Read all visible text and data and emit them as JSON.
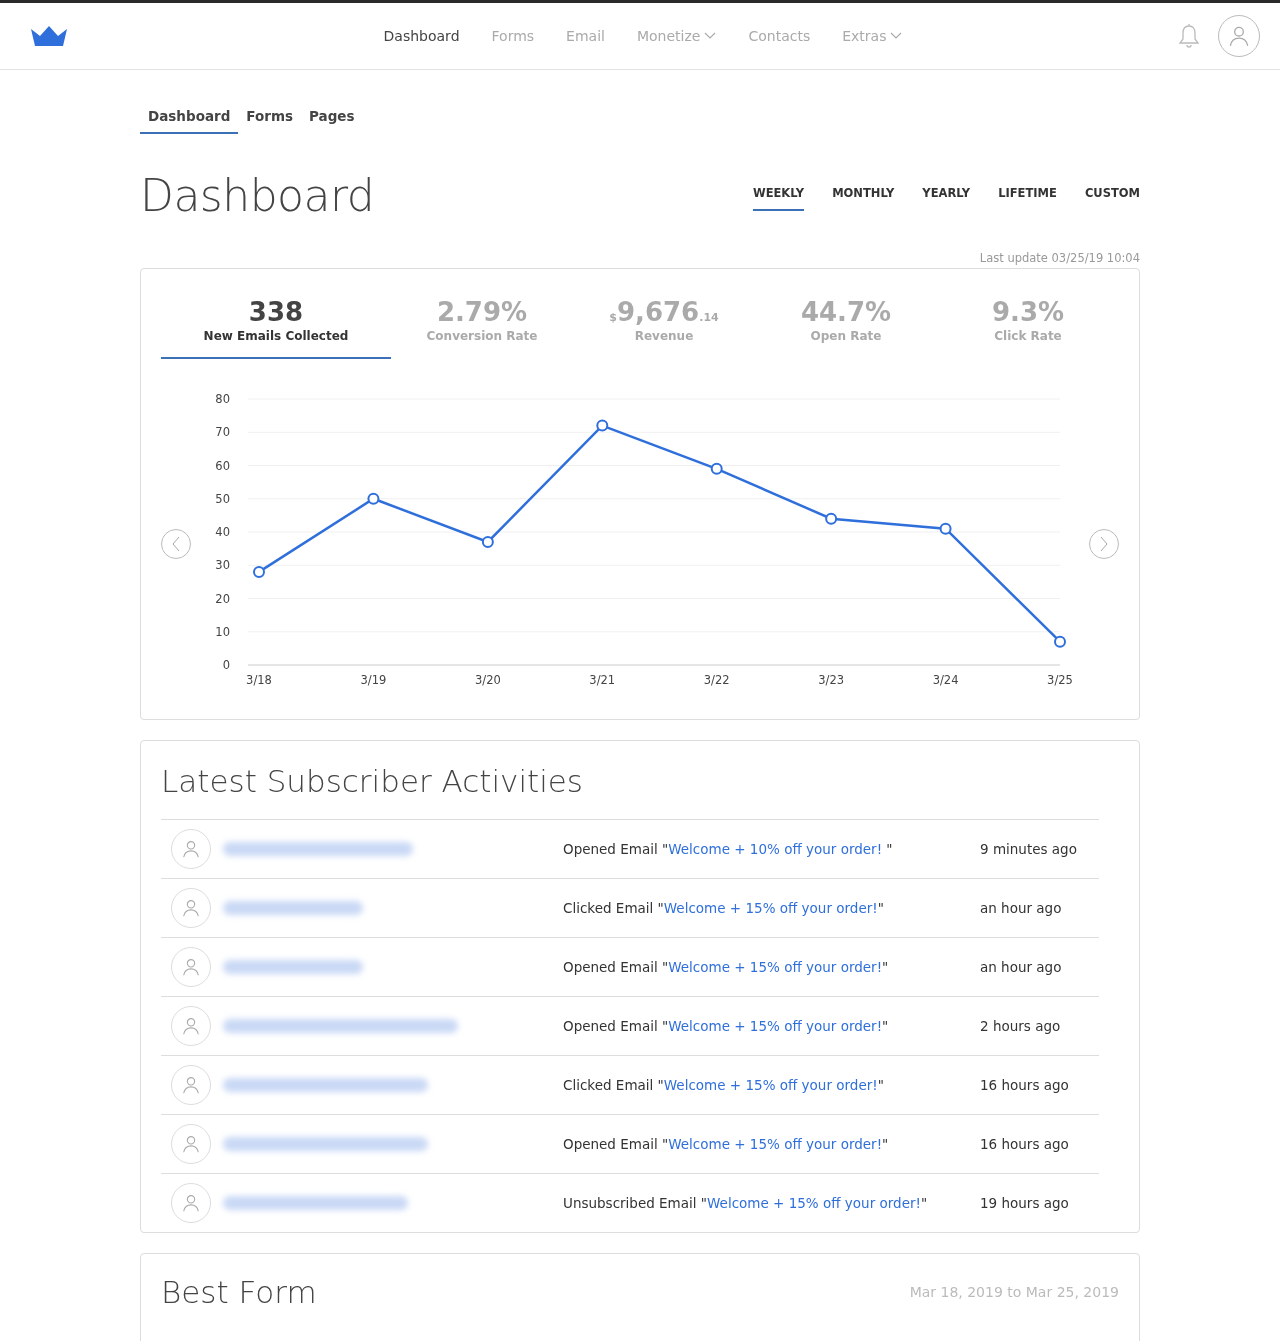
{
  "top_nav": {
    "items": [
      {
        "label": "Dashboard",
        "selected": true,
        "dropdown": false
      },
      {
        "label": "Forms",
        "selected": false,
        "dropdown": false
      },
      {
        "label": "Email",
        "selected": false,
        "dropdown": false
      },
      {
        "label": "Monetize",
        "selected": false,
        "dropdown": true
      },
      {
        "label": "Contacts",
        "selected": false,
        "dropdown": false
      },
      {
        "label": "Extras",
        "selected": false,
        "dropdown": true
      }
    ]
  },
  "sub_tabs": [
    {
      "label": "Dashboard",
      "selected": true
    },
    {
      "label": "Forms",
      "selected": false
    },
    {
      "label": "Pages",
      "selected": false
    }
  ],
  "page_title": "Dashboard",
  "periods": [
    {
      "label": "WEEKLY",
      "selected": true
    },
    {
      "label": "MONTHLY",
      "selected": false
    },
    {
      "label": "YEARLY",
      "selected": false
    },
    {
      "label": "LIFETIME",
      "selected": false
    },
    {
      "label": "CUSTOM",
      "selected": false
    }
  ],
  "last_update": "Last update 03/25/19 10:04",
  "stats": [
    {
      "kind": "plain",
      "value": "338",
      "label": "New Emails Collected",
      "selected": true
    },
    {
      "kind": "plain",
      "value": "2.79%",
      "label": "Conversion Rate",
      "selected": false
    },
    {
      "kind": "money",
      "currency": "$",
      "value": "9,676",
      "cents": ".14",
      "label": "Revenue",
      "selected": false
    },
    {
      "kind": "plain",
      "value": "44.7%",
      "label": "Open Rate",
      "selected": false
    },
    {
      "kind": "plain",
      "value": "9.3%",
      "label": "Click Rate",
      "selected": false
    }
  ],
  "chart_data": {
    "type": "line",
    "categories": [
      "3/18",
      "3/19",
      "3/20",
      "3/21",
      "3/22",
      "3/23",
      "3/24",
      "3/25"
    ],
    "grid": true,
    "series": [
      {
        "color": "#2f6fdb",
        "marker": "circle",
        "values": [
          28,
          50,
          37,
          72,
          59,
          44,
          41,
          7
        ]
      }
    ],
    "ylim": [
      0,
      80
    ],
    "yticks": [
      0,
      10,
      20,
      30,
      40,
      50,
      60,
      70,
      80
    ]
  },
  "activities": {
    "title": "Latest Subscriber Activities",
    "rows": [
      {
        "prefix": "Opened Email \"",
        "link": "Welcome + 10% off your order!",
        "suffix": " \"",
        "time": "9 minutes ago"
      },
      {
        "prefix": "Clicked Email \"",
        "link": "Welcome + 15% off your order!",
        "suffix": "\"",
        "time": "an hour ago"
      },
      {
        "prefix": "Opened Email \"",
        "link": "Welcome + 15% off your order!",
        "suffix": "\"",
        "time": "an hour ago"
      },
      {
        "prefix": "Opened Email \"",
        "link": "Welcome + 15% off your order!",
        "suffix": "\"",
        "time": "2 hours ago"
      },
      {
        "prefix": "Clicked Email \"",
        "link": "Welcome + 15% off your order!",
        "suffix": "\"",
        "time": "16 hours ago"
      },
      {
        "prefix": "Opened Email \"",
        "link": "Welcome + 15% off your order!",
        "suffix": "\"",
        "time": "16 hours ago"
      },
      {
        "prefix": "Unsubscribed Email \"",
        "link": "Welcome + 15% off your order!",
        "suffix": "\"",
        "time": "19 hours ago"
      }
    ]
  },
  "best_form": {
    "title": "Best Form",
    "date_range": "Mar 18, 2019 to Mar 25, 2019"
  }
}
